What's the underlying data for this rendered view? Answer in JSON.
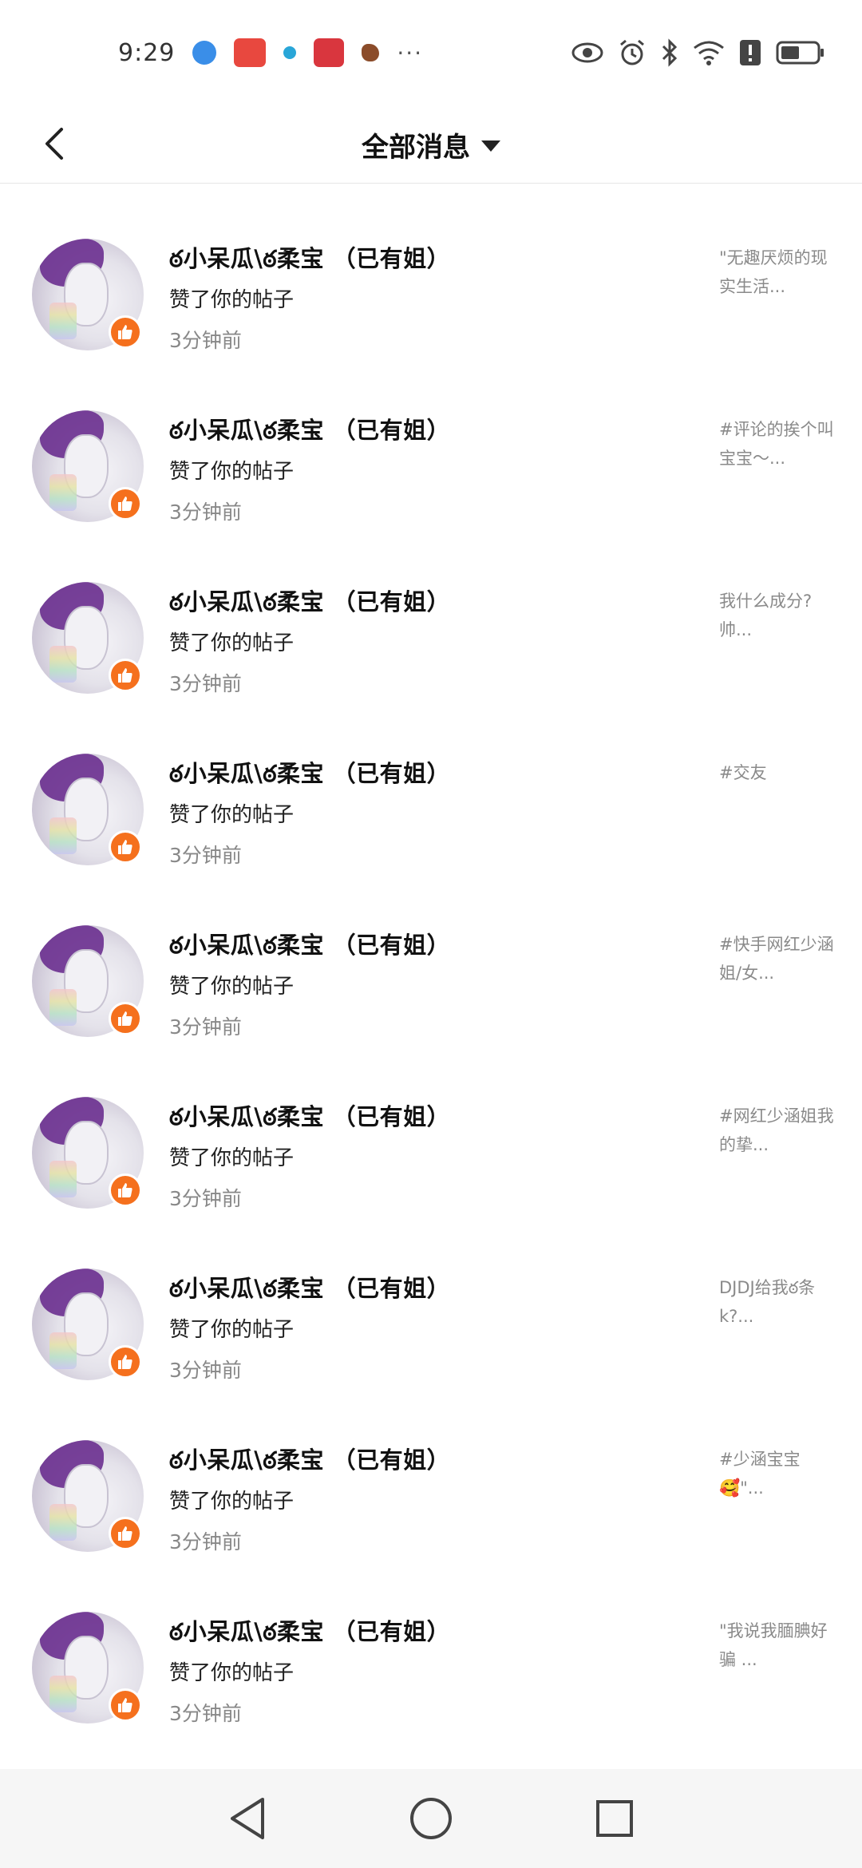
{
  "status_bar": {
    "time": "9​:29",
    "app_icons": [
      "globe-icon",
      "huawei-appgallery-icon",
      "dot-icon",
      "book-icon",
      "bird-icon"
    ],
    "more": "···",
    "indicators": [
      "eye-icon",
      "alarm-icon",
      "bluetooth-icon",
      "wifi-icon",
      "alert-icon",
      "battery-icon"
    ]
  },
  "header": {
    "title": "全部消息"
  },
  "colors": {
    "like_badge": "#f5701d",
    "divider": "#e6e6e6",
    "nav_bg": "#f6f6f6"
  },
  "messages": [
    {
      "username": "ఠ小呆瓜\\ఠ柔宝 （已有姐）",
      "action": "赞了你的帖子",
      "time": "3分钟前",
      "preview": "\"无趣厌烦的现实生活..."
    },
    {
      "username": "ఠ小呆瓜\\ఠ柔宝 （已有姐）",
      "action": "赞了你的帖子",
      "time": "3分钟前",
      "preview": "#评论的挨个叫宝宝～..."
    },
    {
      "username": "ఠ小呆瓜\\ఠ柔宝 （已有姐）",
      "action": "赞了你的帖子",
      "time": "3分钟前",
      "preview": "我什么成分?帅..."
    },
    {
      "username": "ఠ小呆瓜\\ఠ柔宝 （已有姐）",
      "action": "赞了你的帖子",
      "time": "3分钟前",
      "preview": "#交友"
    },
    {
      "username": "ఠ小呆瓜\\ఠ柔宝 （已有姐）",
      "action": "赞了你的帖子",
      "time": "3分钟前",
      "preview": "#快手网红少涵姐/女..."
    },
    {
      "username": "ఠ小呆瓜\\ఠ柔宝 （已有姐）",
      "action": "赞了你的帖子",
      "time": "3分钟前",
      "preview": "#网红少涵姐我的挚..."
    },
    {
      "username": "ఠ小呆瓜\\ఠ柔宝 （已有姐）",
      "action": "赞了你的帖子",
      "time": "3分钟前",
      "preview": "DJDJ给我ఠ条k?..."
    },
    {
      "username": "ఠ小呆瓜\\ఠ柔宝 （已有姐）",
      "action": "赞了你的帖子",
      "time": "3分钟前",
      "preview": "#少涵宝宝🥰\"..."
    },
    {
      "username": "ఠ小呆瓜\\ఠ柔宝 （已有姐）",
      "action": "赞了你的帖子",
      "time": "3分钟前",
      "preview": "\"我说我腼腆好骗 ..."
    }
  ],
  "nav": [
    "back-triangle-icon",
    "home-circle-icon",
    "recents-square-icon"
  ]
}
